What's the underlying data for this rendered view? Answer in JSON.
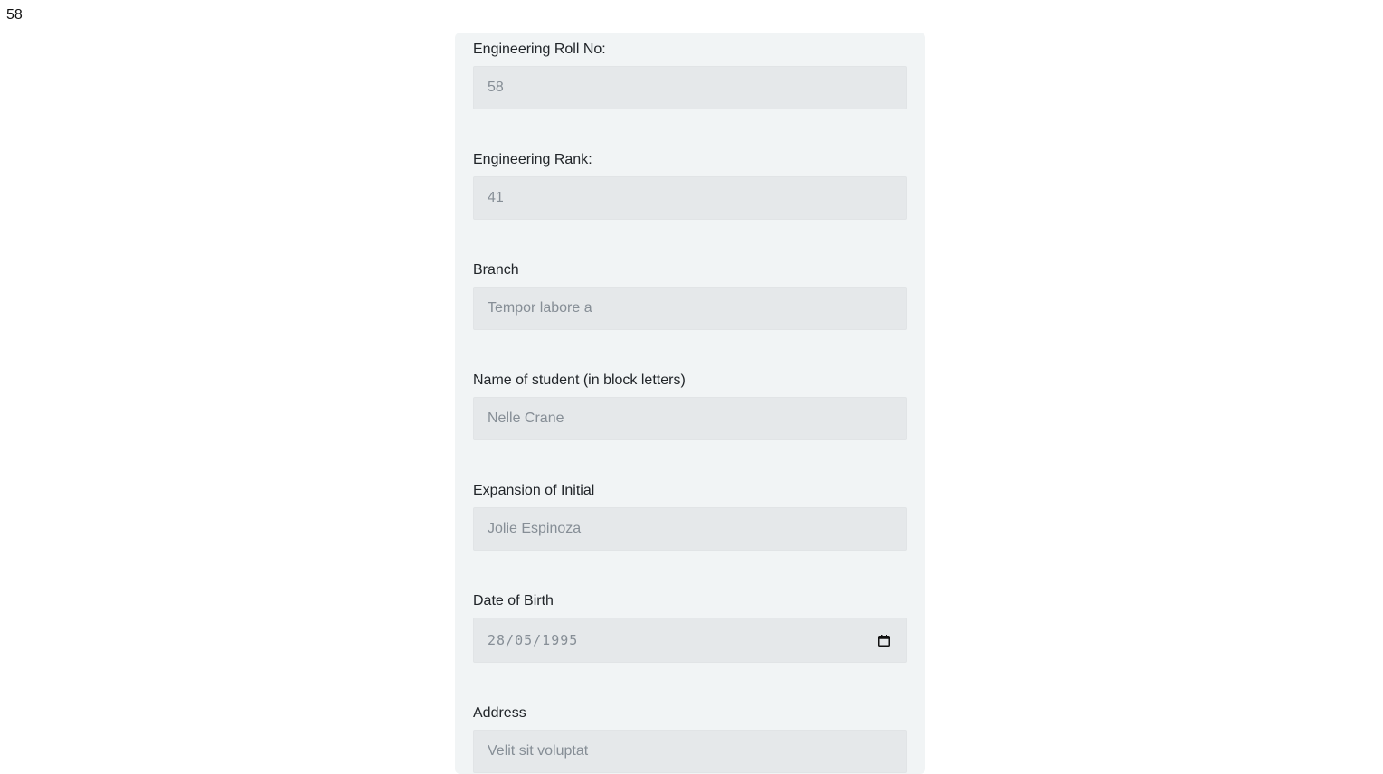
{
  "page_counter": "58",
  "form": {
    "fields": [
      {
        "label": "Engineering Roll No:",
        "value": "58"
      },
      {
        "label": "Engineering Rank:",
        "value": "41"
      },
      {
        "label": "Branch",
        "value": "Tempor labore a"
      },
      {
        "label": "Name of student (in block letters)",
        "value": "Nelle Crane"
      },
      {
        "label": "Expansion of Initial",
        "value": "Jolie Espinoza"
      },
      {
        "label": "Date of Birth",
        "value": "28/05/1995",
        "icon": "calendar-icon"
      },
      {
        "label": "Address",
        "value": "Velit sit voluptat"
      }
    ]
  },
  "colors": {
    "card_background": "#f1f4f5",
    "input_background": "#e5e8ea",
    "input_text": "#868e96"
  }
}
